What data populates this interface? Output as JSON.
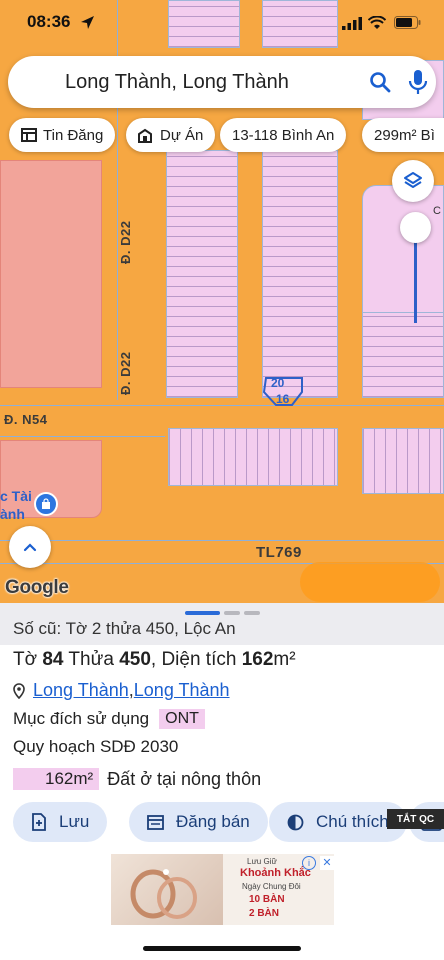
{
  "status_bar": {
    "time": "08:36"
  },
  "search": {
    "text": "Long Thành, Long Thành"
  },
  "chips": [
    {
      "label": "Tin Đăng",
      "icon": "newspaper-icon"
    },
    {
      "label": "Dự Án",
      "icon": "building-icon"
    },
    {
      "label": "13-118 Bình An"
    },
    {
      "label": "299m² Bì"
    }
  ],
  "map": {
    "road_labels": [
      "Đ. D22",
      "Đ. D22",
      "Đ. N54",
      "TL769"
    ],
    "poi_label": [
      "c Tài",
      "ành"
    ],
    "parcel_labels": [
      "20",
      "16"
    ],
    "edge_label": "C",
    "google_logo": "Google"
  },
  "sheet": {
    "old_parcel": "Số cũ: Tờ 2 thửa 450, Lộc An",
    "parcel_prefix": "Tờ ",
    "sheet_no": "84",
    "parcel_mid": " Thửa ",
    "parcel_no": "450",
    "area_label": ", Diện tích ",
    "area_value": "162",
    "area_unit": "m²",
    "location": [
      "Long Thành",
      "Long Thành"
    ],
    "location_sep": ", ",
    "purpose_label": "Mục đích sử dụng",
    "purpose_code": "ONT",
    "plan_label": "Quy hoạch SDĐ 2030",
    "area_badge": "162m²",
    "area_desc": "Đất ở tại nông thôn",
    "actions": [
      "Lưu",
      "Đăng bán",
      "Chú thích"
    ],
    "hide_ad": "TẮT QC"
  },
  "ad": {
    "line1": "Lưu Giữ",
    "line2": "Khoảnh Khắc",
    "line3": "Ngày Chung Đôi",
    "line4": "10 BÀN",
    "line5": "2 BÀN"
  },
  "colors": {
    "road": "#f6a742",
    "residential_lot": "#f3cdee",
    "commercial_lot": "#f2a49a",
    "accent": "#2a6bd8",
    "action_bg": "#dfe8f8"
  }
}
